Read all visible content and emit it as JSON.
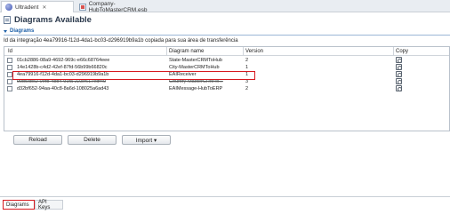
{
  "editor_tabs": [
    {
      "label": "Ultradent",
      "close": "✕"
    },
    {
      "label": "Company-HubToMasterCRM.esb"
    }
  ],
  "form": {
    "title": "Diagrams Available"
  },
  "section": {
    "title": "Diagrams"
  },
  "status_message": "Id da integração 4ea79916-f12d-4da1-bc03-d296919b9a1b copiada para sua área de transferência",
  "table": {
    "headers": {
      "id": "Id",
      "name": "Diagram name",
      "version": "Version",
      "copy": "Copy"
    },
    "rows": [
      {
        "id": "01cb2886-08a9-4692-969c-e66c68764eee",
        "name": "State-MasterCRMToHub",
        "version": "2"
      },
      {
        "id": "14e1428b-c4d2-42ef-87fd-56b99b66820c",
        "name": "City-MasterCRMToHub",
        "version": "1"
      },
      {
        "id": "4ea79916-f12d-4da1-bc03-d296919b9a1b",
        "name": "EAIReceiver",
        "version": "1"
      },
      {
        "id": "99b5cbc2-0efb-48b4-91fa-223e617edf49",
        "name": "Country-MasterCRMTo...",
        "version": "3"
      },
      {
        "id": "d32bf652-94aa-40c8-8a6d-108025a6ad43",
        "name": "EAIMessage-HubToERP",
        "version": "2"
      }
    ]
  },
  "buttons": {
    "reload": "Reload",
    "delete": "Delete",
    "import": "Import ▾"
  },
  "bottom_tabs": {
    "diagrams": "Diagrams",
    "api_keys": "API Keys"
  },
  "colors": {
    "highlight": "#d7191f",
    "section": "#1c5fa8"
  }
}
